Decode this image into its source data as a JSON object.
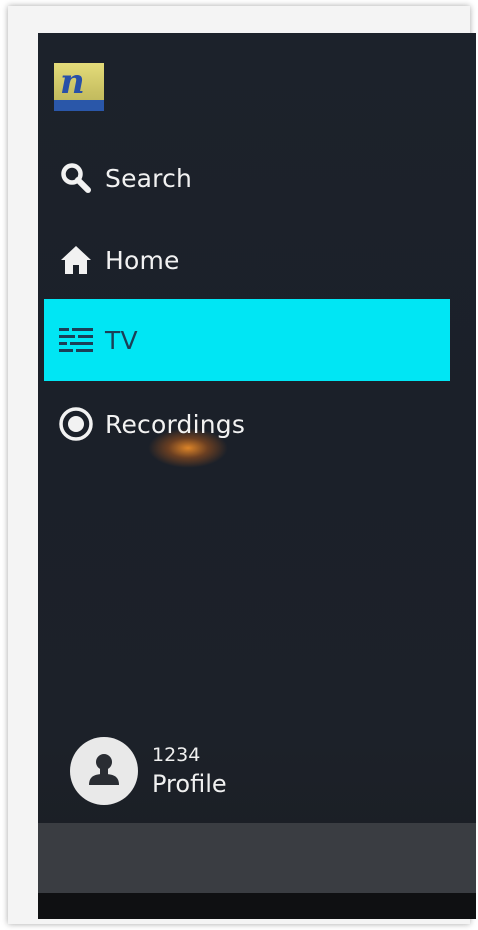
{
  "menu": {
    "items": [
      {
        "label": "Search",
        "icon": "search-icon"
      },
      {
        "label": "Home",
        "icon": "home-icon"
      },
      {
        "label": "TV",
        "icon": "tv-guide-icon",
        "selected": true
      },
      {
        "label": "Recordings",
        "icon": "record-icon"
      }
    ]
  },
  "profile": {
    "id": "1234",
    "label": "Profile",
    "icon": "person-icon"
  },
  "colors": {
    "background": "#1c222b",
    "selected": "#00e6f4",
    "selected_text": "#1b3f57",
    "text": "#f2f2f2"
  }
}
